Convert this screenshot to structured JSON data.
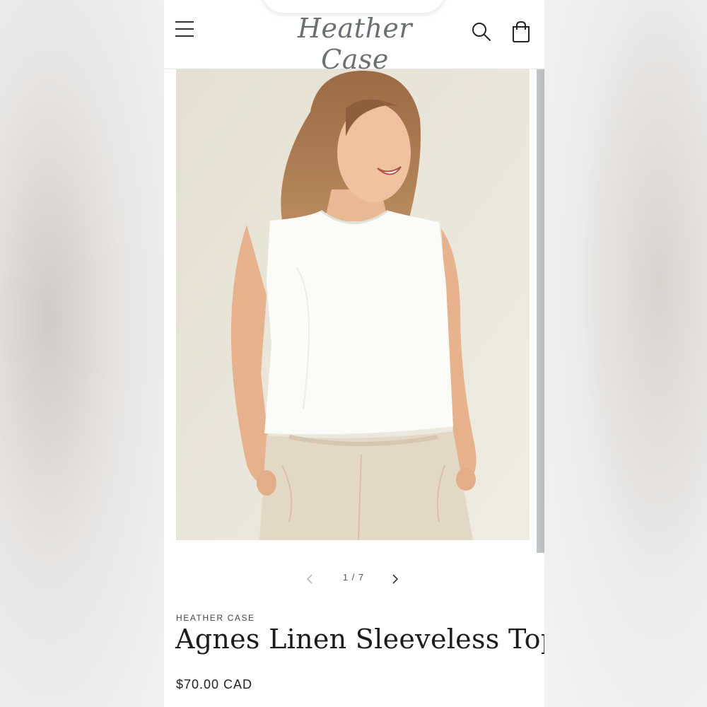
{
  "header": {
    "brand_logo": "Heather Case",
    "menu_icon": "hamburger-menu-icon",
    "search_icon": "search-icon",
    "cart_icon": "shopping-bag-icon"
  },
  "gallery": {
    "image_alt": "Woman wearing a white linen sleeveless top and beige linen pants",
    "counter": "1 / 7",
    "prev_icon": "chevron-left-icon",
    "next_icon": "chevron-right-icon"
  },
  "product": {
    "vendor": "HEATHER CASE",
    "title": "Agnes Linen Sleeveless Top",
    "price": "$70.00 CAD"
  },
  "colors": {
    "background": "#ffffff",
    "text": "#1c1c1c",
    "logo": "#6b6e72"
  }
}
